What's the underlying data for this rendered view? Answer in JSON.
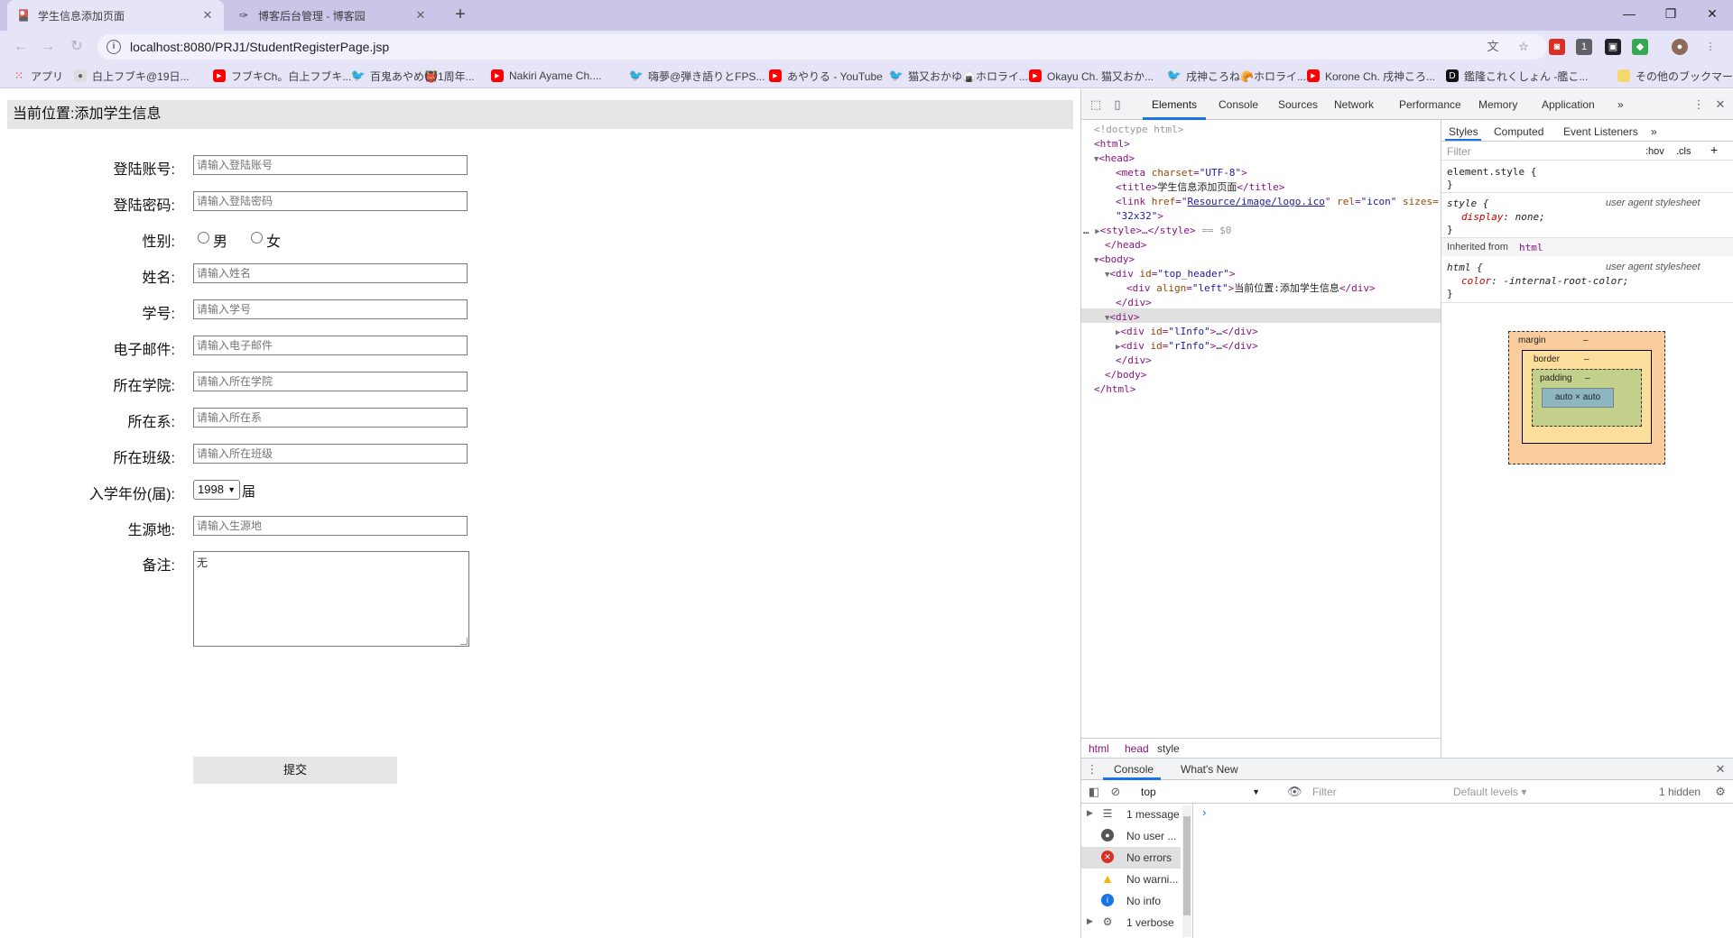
{
  "browser": {
    "tabs": [
      {
        "title": "学生信息添加页面",
        "active": true,
        "favicon": "page-icon"
      },
      {
        "title": "博客后台管理 - 博客园",
        "active": false,
        "favicon": "blog-icon"
      }
    ],
    "url": "localhost:8080/PRJ1/StudentRegisterPage.jsp",
    "bookmarks": [
      {
        "label": "アプリ",
        "icon": "apps"
      },
      {
        "label": "白上フブキ@19日...",
        "icon": "gen"
      },
      {
        "label": "フブキCh。白上フブキ...",
        "icon": "yt"
      },
      {
        "label": "百鬼あやめ👹1周年...",
        "icon": "tw"
      },
      {
        "label": "Nakiri Ayame Ch....",
        "icon": "yt"
      },
      {
        "label": "嗨夢@弾き語りとFPS...",
        "icon": "tw"
      },
      {
        "label": "あやりる - YouTube",
        "icon": "yt"
      },
      {
        "label": "猫又おかゆ🍙ホロライ...",
        "icon": "tw"
      },
      {
        "label": "Okayu Ch. 猫又おか...",
        "icon": "yt"
      },
      {
        "label": "戌神ころね🥐ホロライ...",
        "icon": "tw"
      },
      {
        "label": "Korone Ch. 戌神ころ...",
        "icon": "yt"
      },
      {
        "label": "鑑隆これくしょん -艦こ...",
        "icon": "gen"
      }
    ],
    "other_bookmarks": "その他のブックマーク",
    "extension_badge": "1"
  },
  "page": {
    "header": "当前位置:添加学生信息",
    "fields": [
      {
        "label": "登陆账号:",
        "placeholder": "请输入登陆账号"
      },
      {
        "label": "登陆密码:",
        "placeholder": "请输入登陆密码"
      },
      {
        "label": "姓名:",
        "placeholder": "请输入姓名"
      },
      {
        "label": "学号:",
        "placeholder": "请输入学号"
      },
      {
        "label": "电子邮件:",
        "placeholder": "请输入电子邮件"
      },
      {
        "label": "所在学院:",
        "placeholder": "请输入所在学院"
      },
      {
        "label": "所在系:",
        "placeholder": "请输入所在系"
      },
      {
        "label": "所在班级:",
        "placeholder": "请输入所在班级"
      },
      {
        "label": "生源地:",
        "placeholder": "请输入生源地"
      }
    ],
    "gender": {
      "label": "性别:",
      "options": [
        "男",
        "女"
      ]
    },
    "enrollment_year": {
      "label": "入学年份(届):",
      "value": "1998",
      "unit": "届"
    },
    "remark": {
      "label": "备注:",
      "value": "无"
    },
    "submit": "提交"
  },
  "devtools": {
    "tabs": [
      "Elements",
      "Console",
      "Sources",
      "Network",
      "Performance",
      "Memory",
      "Application"
    ],
    "more": "»",
    "dom": {
      "doctype": "<!doctype html>",
      "html_open": "<html>",
      "head_open": "<head>",
      "meta": {
        "attr": "charset",
        "val": "\"UTF-8\""
      },
      "title": "学生信息添加页面",
      "link": {
        "href": "Resource/image/logo.ico",
        "rel": "\"icon\"",
        "sizes": "sizes=",
        "sizes_val": "\"32x32\""
      },
      "style_line": "…</style>",
      "selected_marker": "== $0",
      "head_close": "</head>",
      "body_open": "<body>",
      "top_header_id": "\"top_header\"",
      "inner_div_align": "\"left\"",
      "inner_div_text": "当前位置:添加学生信息",
      "lInfo": "\"lInfo\"",
      "rInfo": "\"rInfo\"",
      "ellipsis": "…",
      "body_close": "</body>",
      "html_close": "</html>"
    },
    "breadcrumbs": [
      "html",
      "head",
      "style"
    ],
    "styles": {
      "tabs": [
        "Styles",
        "Computed",
        "Event Listeners"
      ],
      "filter": "Filter",
      "hov": ":hov",
      "cls": ".cls",
      "element_style": "element.style {",
      "rule1_selector": "style {",
      "rule1_source": "user agent stylesheet",
      "rule1_prop": "display",
      "rule1_val": "none;",
      "inherited": "Inherited from",
      "inherited_tag": "html",
      "rule2_selector": "html {",
      "rule2_source": "user agent stylesheet",
      "rule2_prop": "color",
      "rule2_val": "-internal-root-color;",
      "box": {
        "margin": "margin",
        "border": "border",
        "padding": "padding",
        "content": "auto × auto",
        "dash": "–"
      }
    },
    "drawer": {
      "tabs": [
        "Console",
        "What's New"
      ],
      "context": "top",
      "filter": "Filter",
      "levels": "Default levels ▾",
      "hidden": "1 hidden",
      "sidebar": [
        {
          "label": "1 message",
          "icon": "list-icon"
        },
        {
          "label": "No user ...",
          "icon": "user-icon"
        },
        {
          "label": "No errors",
          "icon": "error-icon"
        },
        {
          "label": "No warni...",
          "icon": "warning-icon"
        },
        {
          "label": "No info",
          "icon": "info-icon"
        },
        {
          "label": "1 verbose",
          "icon": "verbose-icon"
        }
      ],
      "prompt": "›"
    }
  },
  "colors": {
    "tabstrip": "#c9c6e8",
    "toolbar": "#e6e4f7",
    "accent": "#1a73e8"
  }
}
